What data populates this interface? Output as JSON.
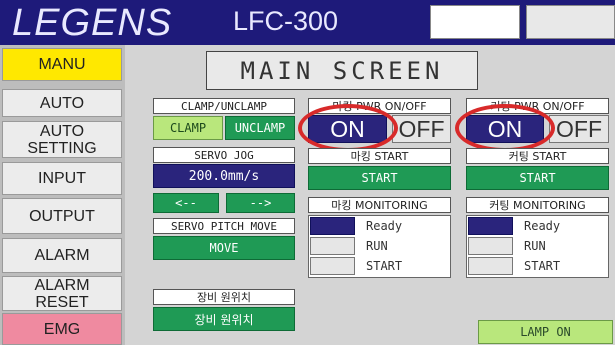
{
  "header": {
    "logo": "LEGENS",
    "model": "LFC-300"
  },
  "sidebar": {
    "items": [
      {
        "label": "MANU"
      },
      {
        "label": "AUTO"
      },
      {
        "label": "AUTO\nSETTING"
      },
      {
        "label": "INPUT"
      },
      {
        "label": "OUTPUT"
      },
      {
        "label": "ALARM"
      },
      {
        "label": "ALARM\nRESET"
      },
      {
        "label": "EMG"
      }
    ]
  },
  "main": {
    "title": "MAIN  SCREEN",
    "clamp": {
      "label": "CLAMP/UNCLAMP",
      "clamp_btn": "CLAMP",
      "unclamp_btn": "UNCLAMP"
    },
    "servo": {
      "label": "SERVO JOG",
      "speed": "200.0mm/s",
      "left_btn": "<--",
      "right_btn": "-->",
      "pitch_label": "SERVO PITCH MOVE",
      "move_btn": "MOVE"
    },
    "origin": {
      "label": "장비 원위치",
      "btn": "장비 원위치"
    },
    "marking": {
      "pwr_label": "마킹 PWR ON/OFF",
      "on": "ON",
      "off": "OFF",
      "start_label": "마킹 START",
      "start_btn": "START",
      "mon_label": "마킹 MONITORING",
      "mon": [
        "Ready",
        "RUN",
        "START"
      ]
    },
    "cutting": {
      "pwr_label": "커팅 PWR ON/OFF",
      "on": "ON",
      "off": "OFF",
      "start_label": "커팅 START",
      "start_btn": "START",
      "mon_label": "커팅 MONITORING",
      "mon": [
        "Ready",
        "RUN",
        "START"
      ]
    },
    "lamp": "LAMP ON"
  },
  "colors": {
    "header": "#1e1a7a",
    "active_nav": "#ffe800",
    "emg": "#ef8aa0",
    "green_button": "#1f9a55",
    "light_green": "#b9e77c",
    "navy_indicator": "#2a247c",
    "highlight_ring": "#d82a2a"
  }
}
